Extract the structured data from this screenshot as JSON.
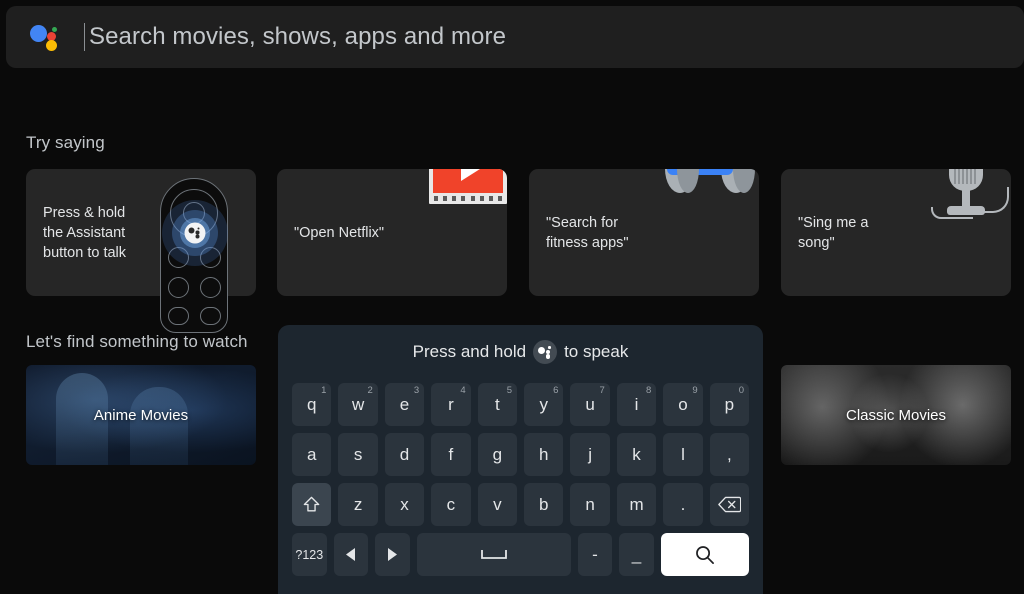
{
  "search": {
    "placeholder": "Search movies, shows, apps and more",
    "value": "",
    "assistant_icon": "google-assistant-icon",
    "colors": {
      "blue": "#4285f4",
      "red": "#ea4335",
      "yellow": "#fbbc05",
      "green": "#34a853"
    }
  },
  "sections": {
    "try_saying_title": "Try saying",
    "find_to_watch_title": "Let's find something to watch"
  },
  "try_saying": {
    "cards": [
      {
        "caption": "Press & hold\nthe Assistant\nbutton to talk",
        "art": "tv-remote-assistant-icon"
      },
      {
        "caption": "\"Open Netflix\"",
        "art": "film-strip-play-icon"
      },
      {
        "caption": "\"Search for\nfitness apps\"",
        "art": "dumbbell-icon"
      },
      {
        "caption": "\"Sing me a\nsong\"",
        "art": "microphone-music-notes-icon"
      }
    ]
  },
  "watch_row": {
    "cards": [
      {
        "label": "Anime Movies"
      },
      {
        "label": "Classic Movies"
      }
    ]
  },
  "keyboard": {
    "hint_prefix": "Press and hold",
    "hint_suffix": "to speak",
    "hint_icon": "assistant-badge-icon",
    "rows": [
      [
        {
          "label": "q",
          "sup": "1"
        },
        {
          "label": "w",
          "sup": "2"
        },
        {
          "label": "e",
          "sup": "3"
        },
        {
          "label": "r",
          "sup": "4"
        },
        {
          "label": "t",
          "sup": "5"
        },
        {
          "label": "y",
          "sup": "6"
        },
        {
          "label": "u",
          "sup": "7"
        },
        {
          "label": "i",
          "sup": "8"
        },
        {
          "label": "o",
          "sup": "9"
        },
        {
          "label": "p",
          "sup": "0"
        }
      ],
      [
        {
          "label": "a"
        },
        {
          "label": "s"
        },
        {
          "label": "d"
        },
        {
          "label": "f"
        },
        {
          "label": "g"
        },
        {
          "label": "h"
        },
        {
          "label": "j"
        },
        {
          "label": "k"
        },
        {
          "label": "l"
        },
        {
          "label": ","
        }
      ],
      [
        {
          "label": "",
          "icon": "shift-icon",
          "focused": true
        },
        {
          "label": "z"
        },
        {
          "label": "x"
        },
        {
          "label": "c"
        },
        {
          "label": "v"
        },
        {
          "label": "b"
        },
        {
          "label": "n"
        },
        {
          "label": "m"
        },
        {
          "label": "."
        },
        {
          "label": "",
          "icon": "backspace-icon"
        }
      ],
      [
        {
          "label": "?123"
        },
        {
          "label": "",
          "icon": "arrow-left-icon"
        },
        {
          "label": "",
          "icon": "arrow-right-icon"
        },
        {
          "label": "",
          "icon": "space-icon"
        },
        {
          "label": "-"
        },
        {
          "label": "_"
        },
        {
          "label": "",
          "icon": "search-icon"
        }
      ]
    ]
  }
}
